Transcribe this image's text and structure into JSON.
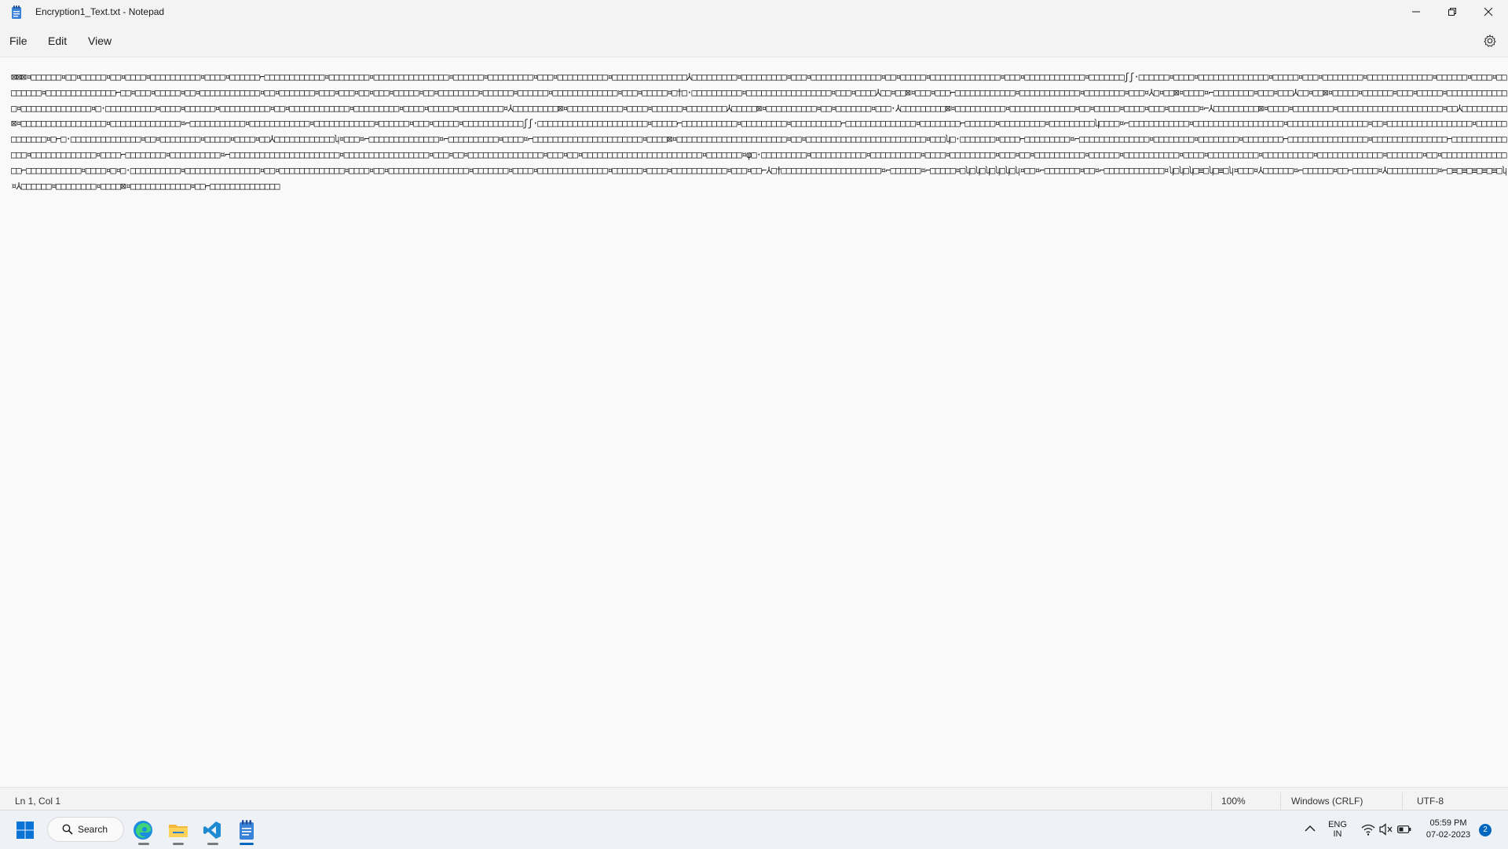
{
  "window": {
    "title": "Encryption1_Text.txt - Notepad"
  },
  "menu": {
    "file": "File",
    "edit": "Edit",
    "view": "View"
  },
  "editor": {
    "content": "⊠⊠⊠¤□□□□□□¤□□¤□□□□□¤□□¤□□□□¤□□□□□□□□□□¤□□□□¤□□□□□□⌐□□□□□□□□□□□□¤□□□□□□□□¤□□□□□□□□□□□□□□□¤□□□□□□¤□□□□□□□□□¤□□□¤□□□□□□□□□□¤□□□□□□□□□□□□□□□⅄□□□□□□□□□¤□□□□□□□□□¤□□□¤□□□□□□□□□□□□□□¤□□¤□□□□□¤□□□□□□□□□□□□□□¤□□□¤□□□□□□□□□□□□¤□□□□□□□ʃʃ·□□□□□□¤□□□□¤□□□□□□□□□□□□□□¤□□□□□¤□□□¤□□□□□□□□¤□□□□□□□□□□□□□¤□□□□□□¤□□□□¤□□□□□□□□¤□□□□□□□□□□□□□□⌐□□¤□□□¤□□□□□¤□□¤□□□□□□□□□□□□¤□□¤□□□□□□□¤□□□¤□□□¤□□¤□□□¤□□□□□¤□□¤□□□□□□□□¤□□□□□□¤□□□□□□¤□□□□□□□□□□□□□¤□□□¤□□□□□¤□†□·□□□□□□□□□□¤□□□□□□□□□□□□□□□□□¤□□□¤□□□□⅄□□¤□□⊠¤□□□¤□□□⌐□□□□□□□□□□□□¤□□□□□□□□□□□□¤□□□□□□□□¤□□□¤⅄□¤□□⊠¤□□□□¤⌐□□□□□□□□¤□□□¤□□□⅄□□¤□□⊠¤□□□□□¤□□□□□□¤□□□¤□□□□□¤□□□□□□□□□□□□□¤□□□□□□□□□□□□□□¤□·□□□□□□□□□□¤□□□□¤□□□□□□¤□□□□□□□□□□¤□□¤□□□□□□□□□□□□¤□□□□□□□□□¤□□□□¤□□□□□¤□□□□□□□□□¤⅄□□□□□□□□□⊠¤□□□□□□□□□□□¤□□□□¤□□□□□□¤□□□□□□□□⅄□□□□□⊠¤□□□□□□□□□□¤□□¤□□□□□□□¤□□□·⅄□□□□□□□□□⊠¤□□□□□□□□□□¤□□□□□□□□□□□□□¤□□¤□□□□□¤□□□□¤□□□¤□□□□□□¤⌐⅄□□□□□□□□□⊠¤□□□□¤□□□□□□□□¤□□□□□□□□□□□□□□□□□□□□□¤□□⅄□□□□□□□□□⊠¤□□□□□□□□□□□□□□□□□¤□□□□□□□□□□□□□□¤⌐□□□□□□□□□□□¤□□□□□□□□□□□□¤□□□□□□□□□□□□¤□□□□□□¤□□□¤□□□□□¤□□□□□□□□□□□□ʃʃ·□□□□□□□□□□□□□□□□□□□□□□¤□□□□□⌐□□□□□□□□□□□¤□□□□□□□□□¤□□□□□□□□□□⌐□□□□□□□□□□□□□□¤□□□□□□□□⌐□□□□□□¤□□□□□□□□□¤□□□□□□□□□ʮ□□□□¤⌐□□□□□□□□□□□□¤□□□□□□□□□□□□□□□□□□¤□□□□□□□□□□□□□□□□¤□□¤□□□□□□□□□□□□□□□□□¤□□□□□□□□□□□□□¤□⌐□·□□□□□□□□□□□□□□¤□□¤□□□□□□□□¤□□□□□¤□□□□¤□□⅄□□□□□□□□□□□□ʮ¤□□□¤⌐□□□□□□□□□□□□□□¤⌐□□□□□□□□□□¤□□□□¤⌐□□□□□□□□□□□□□□□□□□□□□□¤□□□□⊠¤□□□□□□□□□□□□□□□□□□□□□□¤□□¤□□□□□□□□□□□□□□□□□□□□□□□□¤□□□ʮ□·□□□□□□□¤□□□□⌐□□□□□□□□□¤⌐□□□□□□□□□□□□□□¤□□□□□□□□¤□□□□□□□□¤□□□□□□□□⌐□□□□□□□□□□□□□□□□¤□□□□□□□□□□□□□□□⌐□□□□□□□□□□□□□□¤□□□□□□□□□□□□□¤□□□□⌐□□□□□□□□¤□□□□□□□□□□¤⌐□□□□□□□□□□□□□□□□□□□□□□¤□□□□□□□□□□□□□□□□□¤□□□¤□□¤□□□□□□□□□□□□□□□¤□□□¤□□¤□□□□□□□□□□□□□□□□□□□□□□□□¤□□□□□□□¤φ□·□□□□□□□□□¤□□□□□□□□□□□¤□□□□□□□□□□¤□□□□¤□□□□□□□□□¤□□□¤□□¤□□□□□□□□□□¤□□□□□□¤□□□□□□□□□□□¤□□□□¤□□□□□□□□□□¤□□□□□□□□□□¤□□□□□□□□□□□□□¤□□□□□□□¤□□¤□□□□□□□□□□□□□□□⌐□□□□□□□□□□□¤□□□□¤□¤□·□□□□□□□□□□¤□□□□□□□□□□□□□□□¤□□¤□□□□□□□□□□□□□¤□□□□¤□□¤□□□□□□□□□□□□□□□□¤□□□□□□□¤□□□□¤□□□□□□□□□□□□□□¤□□□□□□¤□□□□¤□□□□□□□□□□□¤□□□¤□□⌐⅄□†□□□□□□□□□□□□□□□□□□□□¤⌐□□□□□□¤⌐□□□□□¤□ʮ□ʮ□ʮ□ʮ□ʮ□ʮ¤□□¤⌐□□□□□□□¤□□¤⌐□□□□□□□□□□□□¤ʮ□ʮ□ʮ□≡□ʮ□≡□ʮ¤□□□¤⅄□□□□□□¤⌐□□□□□□¤□□⌐□□□□□¤⅄□□□□□□□□□□¤⌐□≡□≡□≡□≡□≡□ʮ¤⅄□□□□□□¤□□□□□□□□¤□□□□⊠¤□□□□□□□□□□□□¤□□⌐□□□□□□□□□□□□□□"
  },
  "status": {
    "position": "Ln 1, Col 1",
    "zoom": "100%",
    "line_ending": "Windows (CRLF)",
    "encoding": "UTF-8"
  },
  "taskbar": {
    "search_label": "Search",
    "lang_top": "ENG",
    "lang_bottom": "IN",
    "time": "05:59 PM",
    "date": "07-02-2023",
    "notification_count": "2"
  }
}
